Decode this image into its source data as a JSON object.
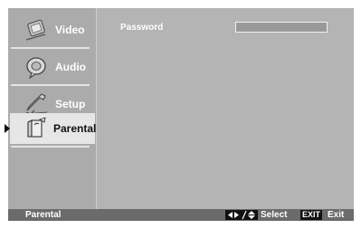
{
  "sidebar": {
    "items": [
      {
        "label": "Video",
        "icon": "video-icon",
        "selected": false
      },
      {
        "label": "Audio",
        "icon": "audio-icon",
        "selected": false
      },
      {
        "label": "Setup",
        "icon": "setup-icon",
        "selected": false
      },
      {
        "label": "Parental",
        "icon": "parental-icon",
        "selected": true
      }
    ]
  },
  "content": {
    "password_label": "Password",
    "password_value": ""
  },
  "statusbar": {
    "title": "Parental",
    "nav_icon": "navigate-arrows-icon",
    "select_label": "Select",
    "exit_key": "EXIT",
    "exit_label": "Exit"
  },
  "colors": {
    "panel": "#b4b4b4",
    "sidebar": "#ababab",
    "selected": "#e6e6e6",
    "statusbar": "#6b6b6b"
  }
}
